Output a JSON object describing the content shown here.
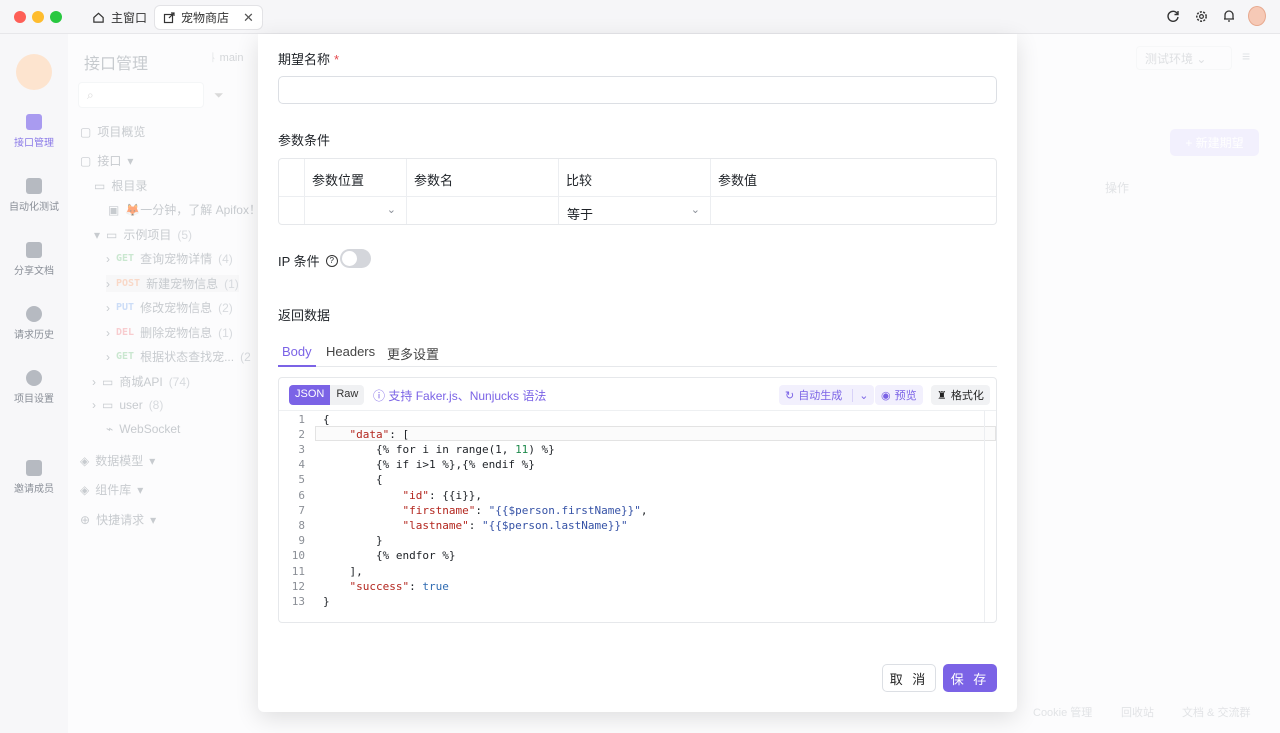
{
  "window": {
    "tabs": [
      {
        "label": "主窗口"
      },
      {
        "label": "宠物商店",
        "close": "✕"
      }
    ]
  },
  "rail": {
    "items": [
      {
        "label": "接口管理"
      },
      {
        "label": "自动化测试"
      },
      {
        "label": "分享文档"
      },
      {
        "label": "请求历史"
      },
      {
        "label": "项目设置"
      },
      {
        "label": "邀请成员"
      }
    ]
  },
  "sidebar": {
    "title": "接口管理",
    "branch": "main",
    "items": [
      {
        "label": "项目概览"
      },
      {
        "label": "接口"
      },
      {
        "label": "根目录"
      },
      {
        "label": "🦊一分钟，了解 Apifox！"
      },
      {
        "label": "示例项目",
        "count": "(5)"
      },
      {
        "method": "GET",
        "label": "查询宠物详情",
        "count": "(4)"
      },
      {
        "method": "POST",
        "label": "新建宠物信息",
        "count": "(1)"
      },
      {
        "method": "PUT",
        "label": "修改宠物信息",
        "count": "(2)"
      },
      {
        "method": "DEL",
        "label": "删除宠物信息",
        "count": "(1)"
      },
      {
        "method": "GET",
        "label": "根据状态查找宠...",
        "count": "(2"
      },
      {
        "label": "商城API",
        "count": "(74)"
      },
      {
        "label": "user",
        "count": "(8)"
      },
      {
        "label": "WebSocket"
      },
      {
        "label": "数据模型"
      },
      {
        "label": "组件库"
      },
      {
        "label": "快捷请求"
      }
    ]
  },
  "background": {
    "env": "测试环境",
    "new_expectation": "+ 新建期望",
    "action_col": "操作",
    "footer": [
      "Cookie 管理",
      "回收站",
      "文档 & 交流群"
    ]
  },
  "modal": {
    "name_label": "期望名称",
    "required_mark": "*",
    "name_value": "",
    "params_label": "参数条件",
    "params_headers": [
      "参数位置",
      "参数名",
      "比较",
      "参数值"
    ],
    "params_row": {
      "position": "",
      "name": "",
      "compare": "等于",
      "value": ""
    },
    "ip_label": "IP 条件",
    "ip_enabled": false,
    "return_label": "返回数据",
    "tabs": [
      "Body",
      "Headers",
      "更多设置"
    ],
    "active_tab": "Body",
    "editor": {
      "modes": [
        "JSON",
        "Raw"
      ],
      "hint": "支持 Faker.js、Nunjucks 语法",
      "auto_gen": "自动生成",
      "preview": "预览",
      "format": "格式化",
      "line_numbers": [
        "1",
        "2",
        "3",
        "4",
        "5",
        "6",
        "7",
        "8",
        "9",
        "10",
        "11",
        "12",
        "13"
      ]
    },
    "cancel": "取 消",
    "save": "保 存"
  }
}
